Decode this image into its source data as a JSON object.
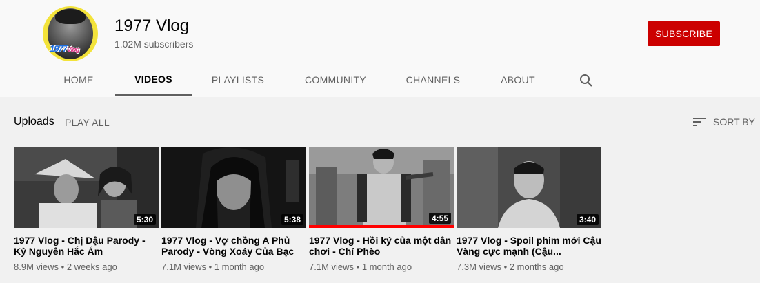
{
  "channel": {
    "name": "1977 Vlog",
    "subscribers": "1.02M subscribers",
    "avatar_logo_main": "1977",
    "avatar_logo_sub": "Vlog",
    "subscribe_label": "SUBSCRIBE"
  },
  "tabs": [
    {
      "label": "HOME"
    },
    {
      "label": "VIDEOS",
      "active": true
    },
    {
      "label": "PLAYLISTS"
    },
    {
      "label": "COMMUNITY"
    },
    {
      "label": "CHANNELS"
    },
    {
      "label": "ABOUT"
    }
  ],
  "section": {
    "title": "Uploads",
    "play_all": "PLAY ALL",
    "sort_by": "SORT BY"
  },
  "videos": [
    {
      "title": "1977 Vlog - Chị Dậu Parody - Kỷ Nguyên Hắc Ám",
      "duration": "5:30",
      "views": "8.9M views",
      "age": "2 weeks ago"
    },
    {
      "title": "1977 Vlog - Vợ chồng A Phủ Parody - Vòng Xoáy Của Bạc",
      "duration": "5:38",
      "views": "7.1M views",
      "age": "1 month ago"
    },
    {
      "title": "1977 Vlog - Hồi ký của một dân chơi - Chí Phèo",
      "duration": "4:55",
      "views": "7.1M views",
      "age": "1 month ago",
      "watched_fraction": 1.0
    },
    {
      "title": "1977 Vlog - Spoil phim mới Cậu Vàng cực mạnh (Cậu...",
      "duration": "3:40",
      "views": "7.3M views",
      "age": "2 months ago"
    }
  ],
  "colors": {
    "subscribe_bg": "#cc0000",
    "progress": "#ff0000",
    "avatar_bg": "#f3e33a"
  }
}
